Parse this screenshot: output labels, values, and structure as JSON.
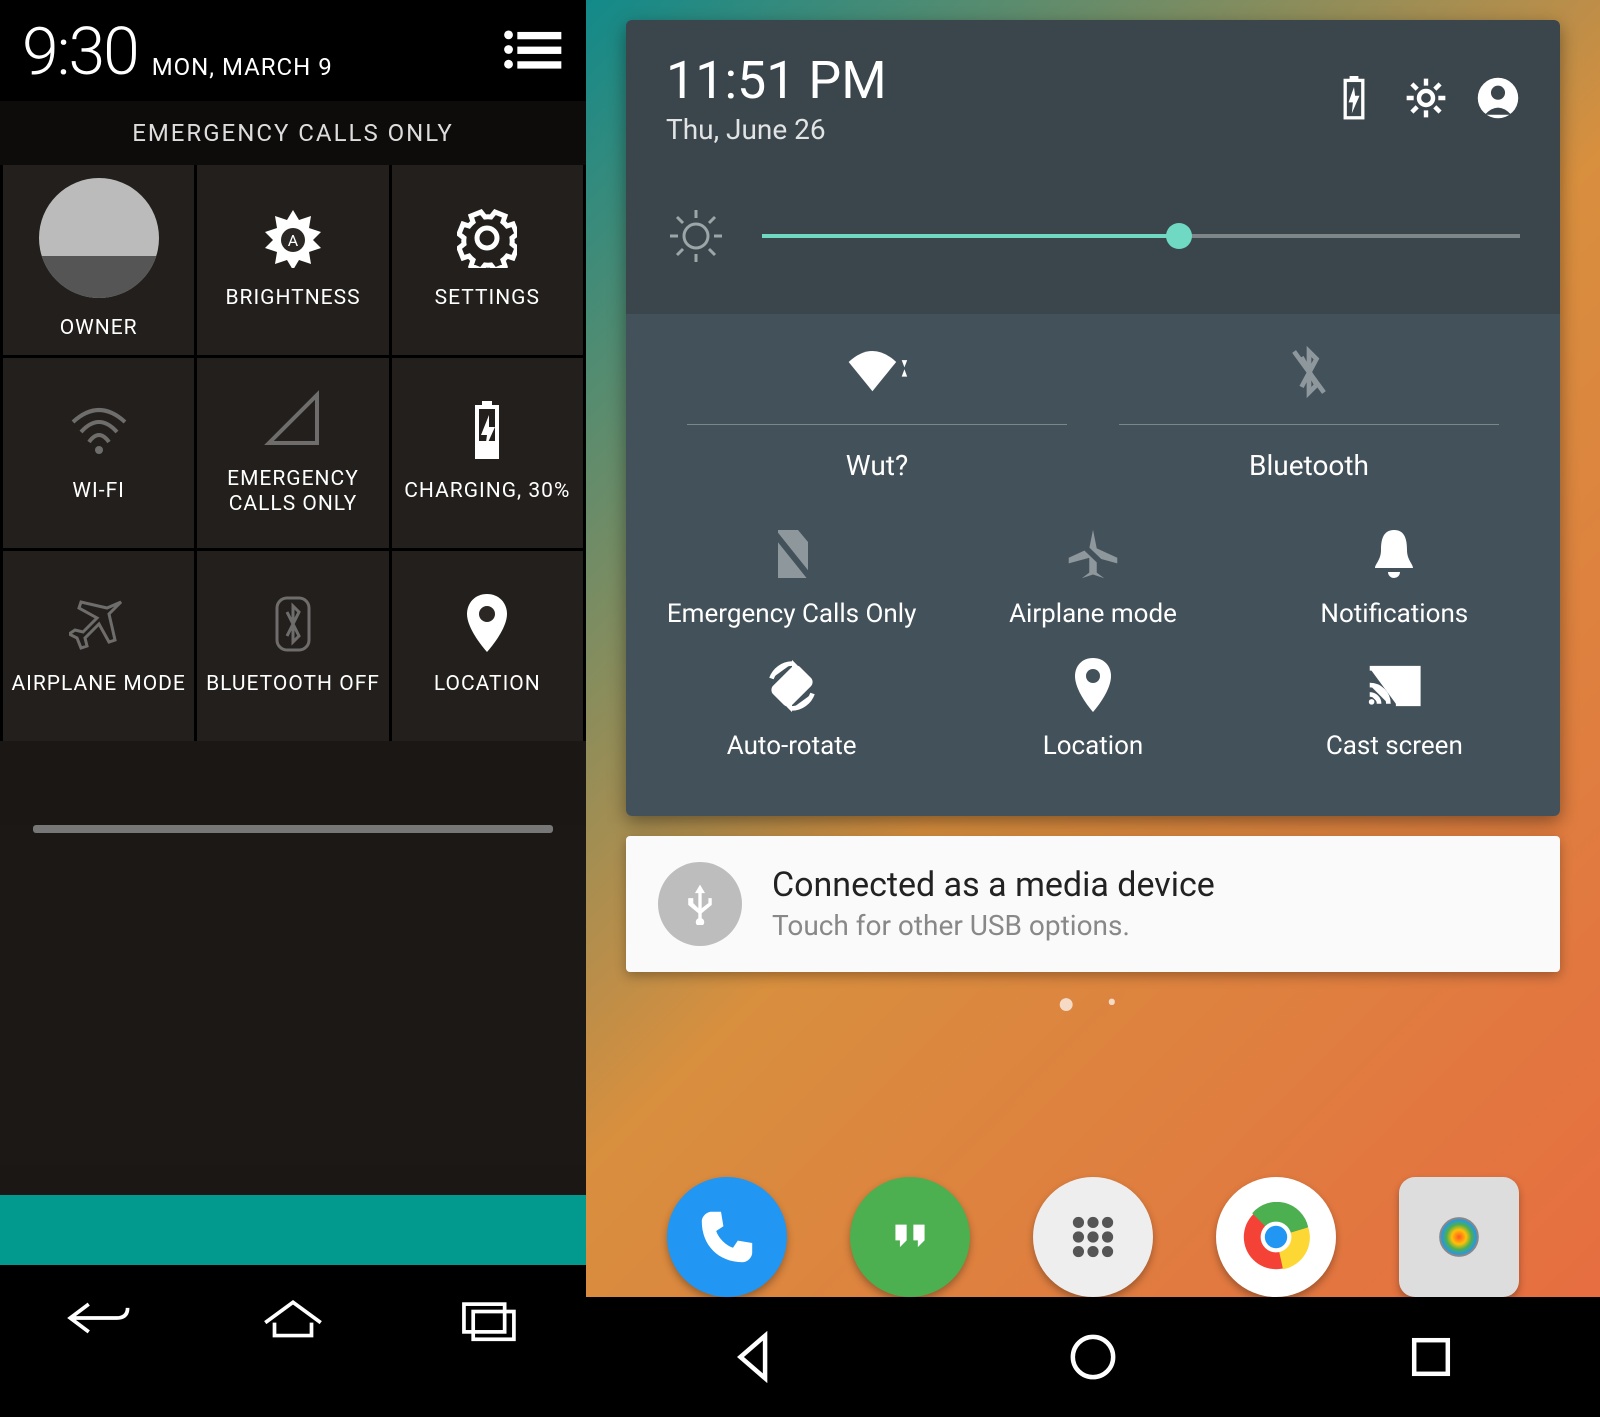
{
  "left": {
    "status": {
      "time": "9:30",
      "date": "MON, MARCH 9"
    },
    "emergency_banner": "EMERGENCY CALLS ONLY",
    "tiles": {
      "owner": "OWNER",
      "brightness": "BRIGHTNESS",
      "settings": "SETTINGS",
      "wifi": "WI-FI",
      "signal": "EMERGENCY CALLS ONLY",
      "battery": "CHARGING, 30%",
      "airplane": "AIRPLANE MODE",
      "bluetooth": "BLUETOOTH OFF",
      "location": "LOCATION"
    }
  },
  "right": {
    "header": {
      "time": "11:51 PM",
      "date": "Thu, June 26"
    },
    "brightness_pct": 55,
    "tiles": {
      "wifi": "Wut?",
      "bluetooth": "Bluetooth",
      "sim": "Emergency Calls Only",
      "airplane": "Airplane mode",
      "notifications": "Notifications",
      "rotate": "Auto-rotate",
      "location": "Location",
      "cast": "Cast screen"
    },
    "notification": {
      "title": "Connected as a media device",
      "subtitle": "Touch for other USB options."
    },
    "dock": {
      "phone": {
        "bg": "#2196f3"
      },
      "hangouts": {
        "bg": "#4caf50"
      },
      "apps": {
        "bg": "#eeeeee"
      },
      "chrome": {
        "bg": "#ffffff"
      },
      "camera": {
        "bg": "#dddddd"
      }
    }
  }
}
